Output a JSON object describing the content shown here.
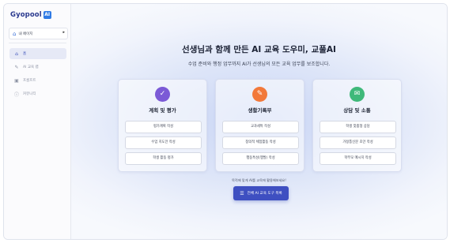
{
  "app": {
    "logo_text": "Gyopool",
    "logo_badge": "AI"
  },
  "sidebar": {
    "mypage": {
      "icon": "home-icon",
      "label": "내 페이지",
      "arrow": "▸"
    },
    "items": [
      {
        "icon": "home-icon",
        "label": "홈",
        "active": true
      },
      {
        "icon": "magic-wand-icon",
        "label": "AI 교육 랩",
        "active": false
      },
      {
        "icon": "layout-icon",
        "label": "프롬프트",
        "active": false
      },
      {
        "icon": "info-icon",
        "label": "커뮤니티",
        "active": false
      }
    ]
  },
  "main": {
    "headline": "선생님과 함께 만든 AI 교육 도우미, 교풀AI",
    "subtitle": "수업 준비와 행정 업무까지 AI가 선생님의 모든 교육 업무를 보조합니다.",
    "cards": [
      {
        "icon": "document-check-icon",
        "color": "#7b5ad6",
        "title": "계획 및 평가",
        "buttons": [
          "평가계획 작성",
          "수업 지도안 작성",
          "학생 활동 평가"
        ]
      },
      {
        "icon": "pen-icon",
        "color": "#f2793a",
        "title": "생활기록부",
        "buttons": [
          "교과세특 작성",
          "창의적 체험활동 작성",
          "행동특성(행발) 작성"
        ]
      },
      {
        "icon": "chat-icon",
        "color": "#3fb97a",
        "title": "상담 및 소통",
        "buttons": [
          "학생 맞춤형 상담",
          "가정통신문 초안 작성",
          "학부모 메시지 작성"
        ]
      }
    ],
    "hint": "목적에 맞게 AI를 교육에 활용해보세요!",
    "cta": {
      "icon": "grid-icon",
      "label": "전체 AI 교육 도구 목록"
    }
  }
}
